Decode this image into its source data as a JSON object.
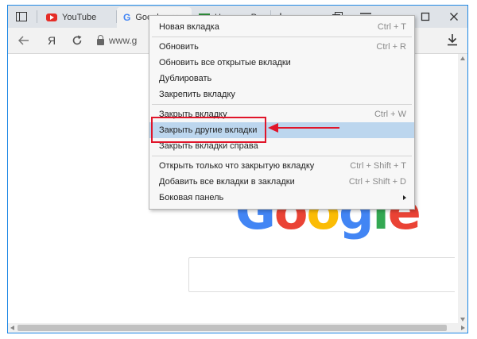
{
  "tabs": [
    {
      "label": "YouTube",
      "icon": "youtube-icon"
    },
    {
      "label": "Google",
      "icon": "google-g-icon"
    },
    {
      "label": "Новости Ро",
      "icon": "news-icon"
    }
  ],
  "tab_close_glyph": "✕",
  "new_tab_glyph": "+",
  "toolbar": {
    "url_text": "www.g",
    "yandex_glyph": "Я"
  },
  "logo": {
    "letters": [
      {
        "char": "G",
        "color": "#4285f4"
      },
      {
        "char": "o",
        "color": "#ea4335"
      },
      {
        "char": "o",
        "color": "#fbbc05"
      },
      {
        "char": "g",
        "color": "#4285f4"
      },
      {
        "char": "l",
        "color": "#34a853"
      },
      {
        "char": "e",
        "color": "#ea4335"
      }
    ]
  },
  "context_menu": {
    "items": [
      {
        "label": "Новая вкладка",
        "shortcut": "Ctrl + T"
      },
      {
        "label": "Обновить",
        "shortcut": "Ctrl + R"
      },
      {
        "label": "Обновить все открытые вкладки",
        "shortcut": ""
      },
      {
        "label": "Дублировать",
        "shortcut": ""
      },
      {
        "label": "Закрепить вкладку",
        "shortcut": ""
      },
      {
        "label": "Закрыть вкладку",
        "shortcut": "Ctrl + W"
      },
      {
        "label": "Закрыть другие вкладки",
        "shortcut": "",
        "highlighted": true
      },
      {
        "label": "Закрыть вкладки справа",
        "shortcut": ""
      },
      {
        "label": "Открыть только что закрытую вкладку",
        "shortcut": "Ctrl + Shift + T"
      },
      {
        "label": "Добавить все вкладки в закладки",
        "shortcut": "Ctrl + Shift + D"
      },
      {
        "label": "Боковая панель",
        "shortcut": "",
        "submenu": true
      }
    ]
  },
  "colors": {
    "highlight": "#bcd6ee",
    "annotation_red": "#e0152a",
    "window_border": "#1e88e5"
  }
}
